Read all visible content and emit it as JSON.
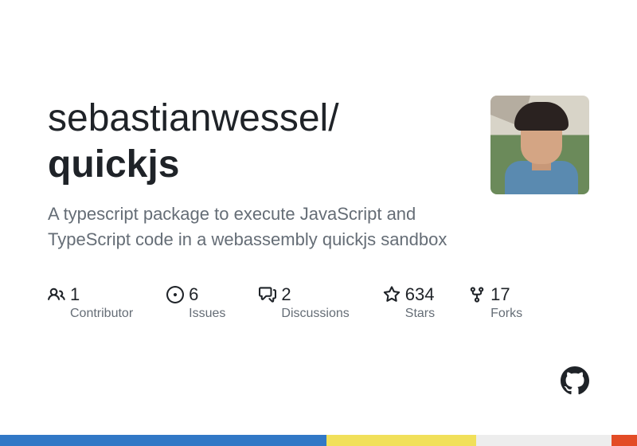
{
  "repo": {
    "owner": "sebastianwessel",
    "name": "quickjs",
    "description": "A typescript package to execute JavaScript and TypeScript code in a webassembly quickjs sandbox"
  },
  "stats": {
    "contributors": {
      "count": "1",
      "label": "Contributor"
    },
    "issues": {
      "count": "6",
      "label": "Issues"
    },
    "discussions": {
      "count": "2",
      "label": "Discussions"
    },
    "stars": {
      "count": "634",
      "label": "Stars"
    },
    "forks": {
      "count": "17",
      "label": "Forks"
    }
  },
  "languages": {
    "typescript": "#3178c6",
    "javascript": "#f1e05a",
    "other": "#ededed",
    "html": "#e34c26"
  }
}
